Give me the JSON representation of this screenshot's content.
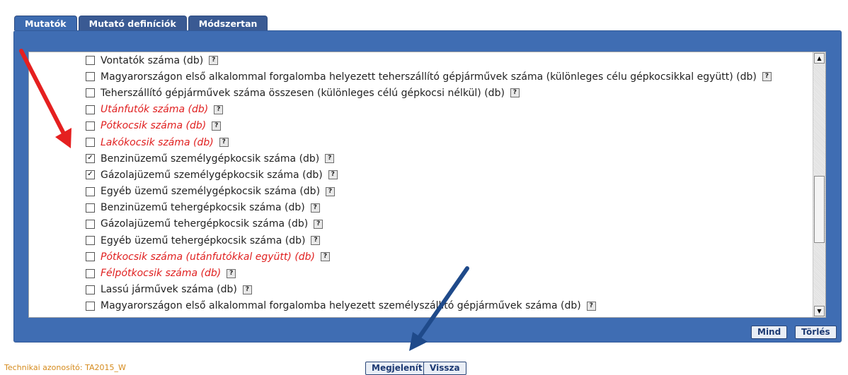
{
  "tabs": [
    {
      "label": "Mutatók",
      "active": true
    },
    {
      "label": "Mutató definíciók",
      "active": false
    },
    {
      "label": "Módszertan",
      "active": false
    }
  ],
  "indicators": [
    {
      "label": "Vontatók száma (db)",
      "checked": false,
      "red": false
    },
    {
      "label": "Magyarországon első alkalommal forgalomba helyezett teherszállító gépjárművek száma (különleges célu gépkocsikkal együtt) (db)",
      "checked": false,
      "red": false
    },
    {
      "label": "Teherszállító gépjárművek száma összesen (különleges célú gépkocsi nélkül) (db)",
      "checked": false,
      "red": false
    },
    {
      "label": "Utánfutók száma (db)",
      "checked": false,
      "red": true
    },
    {
      "label": "Pótkocsik száma (db)",
      "checked": false,
      "red": true
    },
    {
      "label": "Lakókocsik száma (db)",
      "checked": false,
      "red": true
    },
    {
      "label": "Benzinüzemű személygépkocsik száma (db)",
      "checked": true,
      "red": false
    },
    {
      "label": "Gázolajüzemű személygépkocsik száma (db)",
      "checked": true,
      "red": false
    },
    {
      "label": "Egyéb üzemű személygépkocsik száma (db)",
      "checked": false,
      "red": false
    },
    {
      "label": "Benzinüzemű tehergépkocsik száma (db)",
      "checked": false,
      "red": false
    },
    {
      "label": "Gázolajüzemű tehergépkocsik száma (db)",
      "checked": false,
      "red": false
    },
    {
      "label": "Egyéb üzemű tehergépkocsik száma (db)",
      "checked": false,
      "red": false
    },
    {
      "label": "Pótkocsik száma (utánfutókkal együtt) (db)",
      "checked": false,
      "red": true
    },
    {
      "label": "Félpótkocsik száma (db)",
      "checked": false,
      "red": true
    },
    {
      "label": "Lassú járművek száma (db)",
      "checked": false,
      "red": false
    },
    {
      "label": "Magyarországon első alkalommal forgalomba helyezett személyszállító gépjárművek száma (db)",
      "checked": false,
      "red": false
    }
  ],
  "help_glyph": "?",
  "checkbox_checked_glyph": "✓",
  "buttons": {
    "mind": "Mind",
    "torles": "Törlés",
    "megjelenit": "Megjelenít",
    "vissza": "Vissza"
  },
  "footer": {
    "technical_id": "Technikai azonosító: TA2015_W"
  },
  "colors": {
    "panel": "#3f6db3",
    "red_item": "#e02020",
    "arrow_red": "#e52020",
    "arrow_blue": "#1f4a8a",
    "tech_id": "#d58a1c"
  }
}
